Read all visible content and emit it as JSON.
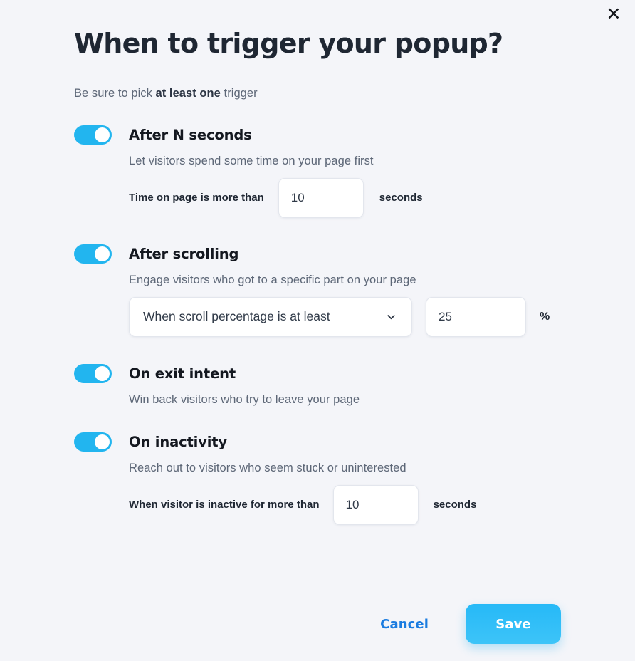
{
  "dialog": {
    "title": "When to trigger your popup?",
    "subtitle_prefix": "Be sure to pick ",
    "subtitle_strong": "at least one",
    "subtitle_suffix": " trigger",
    "close_icon": "close-icon"
  },
  "triggers": [
    {
      "name": "After N seconds",
      "description": "Let visitors spend some time on your page first",
      "enabled": "on",
      "control_label": "Time on page is more than",
      "value": "10",
      "unit": "seconds"
    },
    {
      "name": "After scrolling",
      "description": "Engage visitors who got to a specific part on your page",
      "enabled": "on",
      "select_value": "When scroll percentage is at least",
      "value": "25",
      "unit": "%"
    },
    {
      "name": "On exit intent",
      "description": "Win back visitors who try to leave your page",
      "enabled": "on"
    },
    {
      "name": "On inactivity",
      "description": "Reach out to visitors who seem stuck or uninterested",
      "enabled": "on",
      "control_label": "When visitor is inactive for more than",
      "value": "10",
      "unit": "seconds"
    }
  ],
  "footer": {
    "cancel_label": "Cancel",
    "save_label": "Save"
  },
  "colors": {
    "accent": "#22b5ef",
    "link": "#1b7ce0",
    "background": "#f4f5f9"
  }
}
